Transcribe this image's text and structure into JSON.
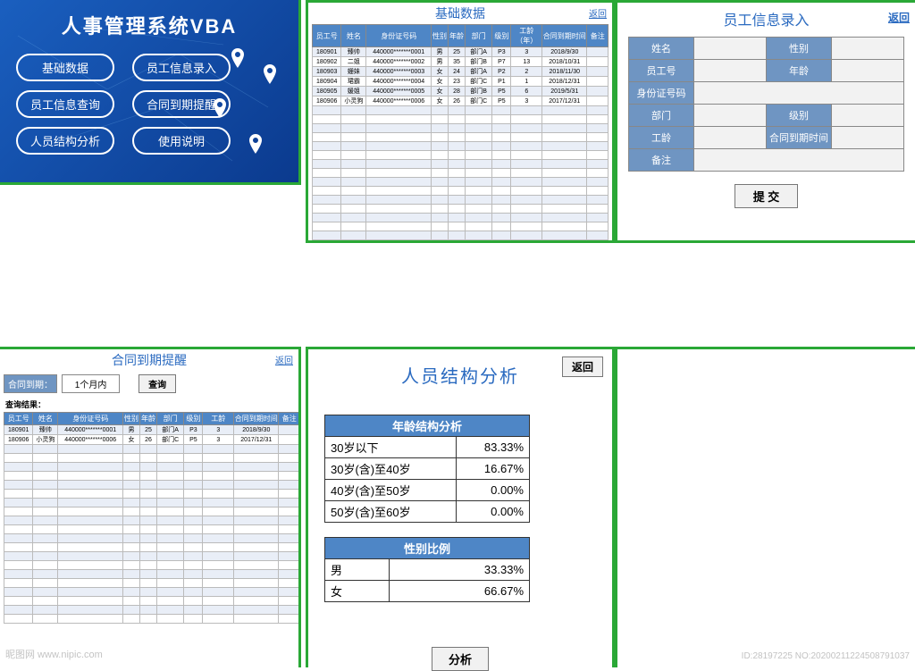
{
  "dashboard": {
    "title": "人事管理系统VBA",
    "buttons": [
      "基础数据",
      "员工信息录入",
      "员工信息查询",
      "合同到期提醒",
      "人员结构分析",
      "使用说明"
    ]
  },
  "base": {
    "title": "基础数据",
    "back": "返回",
    "headers": [
      "员工号",
      "姓名",
      "身份证号码",
      "性别",
      "年龄",
      "部门",
      "级别",
      "工龄（年）",
      "合同到期时间",
      "备注"
    ],
    "rows": [
      [
        "180901",
        "臻帅",
        "440000*******0001",
        "男",
        "25",
        "部门A",
        "P3",
        "3",
        "2018/9/30",
        ""
      ],
      [
        "180902",
        "二姐",
        "440000*******0002",
        "男",
        "35",
        "部门B",
        "P7",
        "13",
        "2018/10/31",
        ""
      ],
      [
        "180903",
        "姗妹",
        "440000*******0003",
        "女",
        "24",
        "部门A",
        "P2",
        "2",
        "2018/11/30",
        ""
      ],
      [
        "180904",
        "珺霸",
        "440000*******0004",
        "女",
        "23",
        "部门C",
        "P1",
        "1",
        "2018/12/31",
        ""
      ],
      [
        "180905",
        "媛姐",
        "440000*******0005",
        "女",
        "28",
        "部门B",
        "P5",
        "6",
        "2019/5/31",
        ""
      ],
      [
        "180906",
        "小灵狗",
        "440000*******0006",
        "女",
        "26",
        "部门C",
        "P5",
        "3",
        "2017/12/31",
        ""
      ]
    ]
  },
  "entry": {
    "title": "员工信息录入",
    "back": "返回",
    "fields": {
      "name": "姓名",
      "gender": "性别",
      "empno": "员工号",
      "age": "年龄",
      "idcard": "身份证号码",
      "dept": "部门",
      "level": "级别",
      "tenure": "工龄",
      "expire": "合同到期时间",
      "remark": "备注"
    },
    "submit": "提 交"
  },
  "reminder": {
    "title": "合同到期提醒",
    "back": "返回",
    "qlabel": "合同到期：",
    "qvalue": "1个月内",
    "qbtn": "查询",
    "reslabel": "查询结果：",
    "headers": [
      "员工号",
      "姓名",
      "身份证号码",
      "性别",
      "年龄",
      "部门",
      "级别",
      "工龄",
      "合同到期时间",
      "备注"
    ],
    "rows": [
      [
        "180901",
        "臻帅",
        "440000*******0001",
        "男",
        "25",
        "部门A",
        "P3",
        "3",
        "2018/9/30",
        ""
      ],
      [
        "180906",
        "小灵狗",
        "440000*******0006",
        "女",
        "26",
        "部门C",
        "P5",
        "3",
        "2017/12/31",
        ""
      ]
    ]
  },
  "analysis": {
    "title": "人员结构分析",
    "back": "返回",
    "analyze": "分析",
    "age_title": "年龄结构分析",
    "age_rows": [
      [
        "30岁以下",
        "83.33%"
      ],
      [
        "30岁(含)至40岁",
        "16.67%"
      ],
      [
        "40岁(含)至50岁",
        "0.00%"
      ],
      [
        "50岁(含)至60岁",
        "0.00%"
      ]
    ],
    "gender_title": "性别比例",
    "gender_rows": [
      [
        "男",
        "33.33%"
      ],
      [
        "女",
        "66.67%"
      ]
    ]
  },
  "watermark": {
    "left": "昵图网 www.nipic.com",
    "right": "ID:28197225 NO:20200211224508791037"
  },
  "chart_data": [
    {
      "type": "table",
      "title": "年龄结构分析",
      "categories": [
        "30岁以下",
        "30岁(含)至40岁",
        "40岁(含)至50岁",
        "50岁(含)至60岁"
      ],
      "values": [
        83.33,
        16.67,
        0.0,
        0.0
      ],
      "unit": "%"
    },
    {
      "type": "table",
      "title": "性别比例",
      "categories": [
        "男",
        "女"
      ],
      "values": [
        33.33,
        66.67
      ],
      "unit": "%"
    }
  ]
}
